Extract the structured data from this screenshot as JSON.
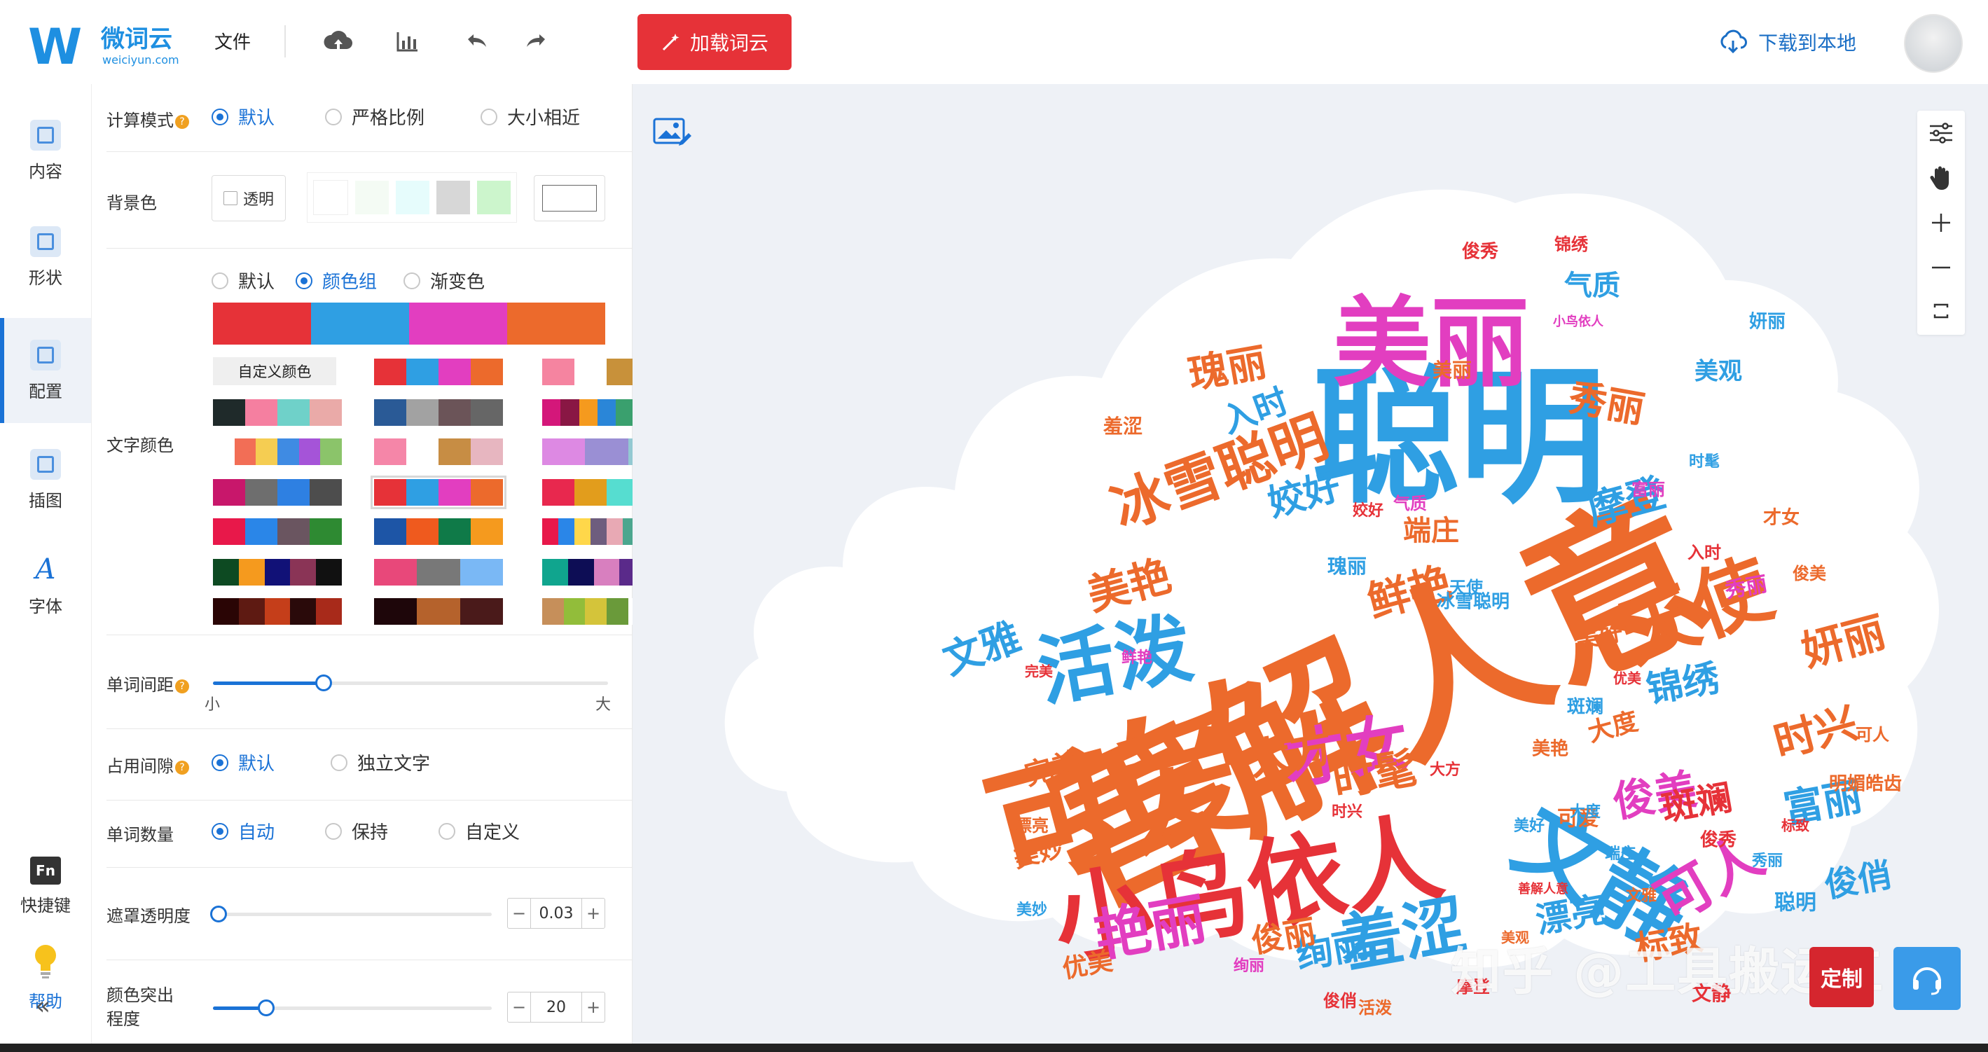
{
  "app": {
    "logo_mark": "W",
    "logo_name": "微词云",
    "logo_url": "weiciyun.com",
    "menu_file": "文件",
    "load_button": "加载词云",
    "download_label": "下载到本地"
  },
  "nav": {
    "items": [
      {
        "label": "内容",
        "icon": "content-icon"
      },
      {
        "label": "形状",
        "icon": "shape-icon"
      },
      {
        "label": "配置",
        "icon": "config-icon"
      },
      {
        "label": "插图",
        "icon": "illustration-icon"
      },
      {
        "label": "字体",
        "icon": "font-icon"
      }
    ],
    "active": "配置",
    "shortcut_label": "快捷键",
    "shortcut_icon_text": "Fn",
    "help_label": "帮助"
  },
  "settings": {
    "calc_mode": {
      "label": "计算模式",
      "options": [
        "默认",
        "严格比例",
        "大小相近"
      ],
      "selected": "默认"
    },
    "background": {
      "label": "背景色",
      "transparent_label": "透明",
      "swatches": [
        "#ffffff",
        "#f4fbf4",
        "#e6fcfc",
        "#d7d7d7",
        "#ccf5cc",
        "#ffd4d4"
      ],
      "current": "#ffffff"
    },
    "text_color": {
      "label": "文字颜色",
      "modes": [
        "默认",
        "颜色组",
        "渐变色"
      ],
      "selected": "颜色组",
      "current_palette": [
        "#e63238",
        "#2f9fe3",
        "#e23ec0",
        "#ec6a2c"
      ],
      "custom_label": "自定义颜色",
      "palettes": [
        [
          "#e63238",
          "#2f9fe3",
          "#e23ec0",
          "#ec6a2c"
        ],
        [
          "#f584a0",
          "#ffffff",
          "#c8913a",
          "#e6b2bd"
        ],
        [
          "#1f2a2a",
          "#f57fa0",
          "#6fd1c9",
          "#eaaaa8"
        ],
        [
          "#2a5a96",
          "#a2a2a2",
          "#6b5458",
          "#666666"
        ],
        [
          "#d4177a",
          "#891744",
          "#f59a1e",
          "#2a86d8",
          "#3aa06e",
          "#999999",
          "#5d5d5d"
        ],
        [
          "#ffffff",
          "#f26e56",
          "#f5cd52",
          "#3f8be3",
          "#a554d8",
          "#8bc46a"
        ],
        [
          "#f586a8",
          "#ffffff",
          "#c78d44",
          "#e7b6c0"
        ],
        [
          "#dd89e3",
          "#9a8fd4",
          "#93c9d2"
        ],
        [
          "#c8176b",
          "#6e6e6e",
          "#2e80e2",
          "#4d4d4d"
        ],
        [
          "#e63238",
          "#2f9fe3",
          "#e23ec0",
          "#ec6a2c"
        ],
        [
          "#e8284e",
          "#e29d1c",
          "#56ddd0",
          "#f7649e"
        ],
        [
          "#e8184a",
          "#2a86e8",
          "#6a5560",
          "#2e8a32"
        ],
        [
          "#1d55a6",
          "#ef5a1e",
          "#0f7a48",
          "#f59a1e"
        ],
        [
          "#e8184a",
          "#2a86e8",
          "#ffd74a",
          "#6e5d7e",
          "#e8a9b4",
          "#4ba68e",
          "#d2b04e",
          "#a1a52c"
        ],
        [
          "#0d4a22",
          "#f59a1e",
          "#111177",
          "#8a3456",
          "#111111"
        ],
        [
          "#e8487a",
          "#787878",
          "#7ab8f5"
        ],
        [
          "#10a58e",
          "#0d0d55",
          "#d87fbf",
          "#5a2a8a",
          "#69f5c1"
        ],
        [
          "#2a0505",
          "#5e1a12",
          "#c53e1a",
          "#2a0a0a",
          "#a82a1a"
        ],
        [
          "#1e060a",
          "#b5622c",
          "#4a1a1a"
        ],
        [
          "#c68f5a",
          "#92bd3a",
          "#d4c43a",
          "#6a9a3a",
          "#ffffff",
          "#a8581a"
        ]
      ]
    },
    "word_spacing": {
      "label": "单词间距",
      "min_label": "小",
      "max_label": "大",
      "value": 0.28
    },
    "occupy_spacing": {
      "label": "占用间隙",
      "options": [
        "默认",
        "独立文字"
      ],
      "selected": "默认"
    },
    "word_count": {
      "label": "单词数量",
      "options": [
        "自动",
        "保持",
        "自定义"
      ],
      "selected": "自动"
    },
    "mask_opacity": {
      "label": "遮罩透明度",
      "value": "0.03",
      "slider": 0.0
    },
    "color_highlight": {
      "label": "颜色突出程度",
      "label_line1": "颜色突出",
      "label_line2": "程度",
      "value": "20",
      "slider": 0.19
    },
    "minus": "−",
    "plus": "+"
  },
  "canvas": {
    "watermark": "知乎 @工具搬运工",
    "badge_text": "定制",
    "colors": {
      "red": "#e63238",
      "blue": "#2f9fe3",
      "magenta": "#e23ec0",
      "orange": "#ec6a2c",
      "cloud": "#ffffff"
    },
    "words": [
      {
        "text": "善解人意",
        "c": "orange",
        "rot": -25
      },
      {
        "text": "聪明",
        "c": "blue",
        "rot": 0
      },
      {
        "text": "可爱",
        "c": "orange",
        "rot": -15
      },
      {
        "text": "美丽",
        "c": "magenta",
        "rot": 0
      },
      {
        "text": "小鸟依人",
        "c": "red",
        "rot": -10
      },
      {
        "text": "文静",
        "c": "blue",
        "rot": 30
      },
      {
        "text": "活泼",
        "c": "blue",
        "rot": -10
      },
      {
        "text": "天使",
        "c": "orange",
        "rot": -20
      },
      {
        "text": "冰雪聪明",
        "c": "orange",
        "rot": -20
      },
      {
        "text": "才女",
        "c": "magenta",
        "rot": -10
      },
      {
        "text": "羞涩",
        "c": "blue",
        "rot": -10
      },
      {
        "text": "艳丽",
        "c": "magenta",
        "rot": -10
      },
      {
        "text": "可人",
        "c": "magenta",
        "rot": -30
      },
      {
        "text": "时髦",
        "c": "orange",
        "rot": -10
      },
      {
        "text": "鲜艳",
        "c": "orange",
        "rot": -15
      },
      {
        "text": "美艳",
        "c": "orange",
        "rot": -15
      },
      {
        "text": "锦绣",
        "c": "blue",
        "rot": -10
      },
      {
        "text": "时兴",
        "c": "orange",
        "rot": -15
      },
      {
        "text": "富丽",
        "c": "blue",
        "rot": -10
      },
      {
        "text": "妍丽",
        "c": "orange",
        "rot": -15
      },
      {
        "text": "瑰丽",
        "c": "orange",
        "rot": -10
      },
      {
        "text": "秀丽",
        "c": "orange",
        "rot": 10
      },
      {
        "text": "俊美",
        "c": "magenta",
        "rot": -10
      },
      {
        "text": "绚丽",
        "c": "blue",
        "rot": -10
      },
      {
        "text": "漂亮",
        "c": "blue",
        "rot": -10
      },
      {
        "text": "俊丽",
        "c": "orange",
        "rot": -10
      },
      {
        "text": "摩登",
        "c": "blue",
        "rot": -15
      },
      {
        "text": "大方",
        "c": "orange",
        "rot": -10
      },
      {
        "text": "斑斓",
        "c": "red",
        "rot": -10
      },
      {
        "text": "姣好",
        "c": "blue",
        "rot": -15
      },
      {
        "text": "文雅",
        "c": "blue",
        "rot": -20
      },
      {
        "text": "入时",
        "c": "blue",
        "rot": -20
      },
      {
        "text": "俊俏",
        "c": "blue",
        "rot": -10
      },
      {
        "text": "标致",
        "c": "orange",
        "rot": -10
      },
      {
        "text": "美好",
        "c": "orange",
        "rot": -10
      },
      {
        "text": "完美",
        "c": "orange",
        "rot": -15
      },
      {
        "text": "大度",
        "c": "orange",
        "rot": -15
      },
      {
        "text": "端庄",
        "c": "orange",
        "rot": 0
      },
      {
        "text": "美妙",
        "c": "orange",
        "rot": -15
      },
      {
        "text": "优美",
        "c": "orange",
        "rot": -10
      },
      {
        "text": "气质",
        "c": "blue",
        "rot": 0
      },
      {
        "text": "美观",
        "c": "blue",
        "rot": 0
      },
      {
        "text": "秀丽",
        "c": "magenta",
        "rot": -10
      },
      {
        "text": "明媚皓齿",
        "c": "orange",
        "rot": 0
      },
      {
        "text": "美丽",
        "c": "orange",
        "rot": 0
      },
      {
        "text": "冰雪聪明",
        "c": "blue",
        "rot": 0
      },
      {
        "text": "妍丽",
        "c": "blue",
        "rot": 0
      },
      {
        "text": "锦绣",
        "c": "red",
        "rot": 0
      },
      {
        "text": "俊秀",
        "c": "red",
        "rot": 0
      },
      {
        "text": "气质",
        "c": "magenta",
        "rot": 0
      },
      {
        "text": "可爱",
        "c": "orange",
        "rot": 0
      },
      {
        "text": "聪明",
        "c": "blue",
        "rot": 0
      },
      {
        "text": "羞涩",
        "c": "orange",
        "rot": 0
      },
      {
        "text": "俊秀",
        "c": "red",
        "rot": 0
      },
      {
        "text": "美艳",
        "c": "orange",
        "rot": 0
      },
      {
        "text": "小鸟依人",
        "c": "magenta",
        "rot": 0
      },
      {
        "text": "时兴",
        "c": "red",
        "rot": 0
      },
      {
        "text": "瑰丽",
        "c": "blue",
        "rot": 0
      },
      {
        "text": "善解人意",
        "c": "red",
        "rot": 0
      },
      {
        "text": "天使",
        "c": "blue",
        "rot": 0
      },
      {
        "text": "鲜艳",
        "c": "magenta",
        "rot": 0
      },
      {
        "text": "漂亮",
        "c": "orange",
        "rot": 0
      },
      {
        "text": "入时",
        "c": "red",
        "rot": 0
      },
      {
        "text": "优美",
        "c": "red",
        "rot": 0
      },
      {
        "text": "文雅",
        "c": "orange",
        "rot": 0
      },
      {
        "text": "可人",
        "c": "orange",
        "rot": 0
      },
      {
        "text": "斑斓",
        "c": "blue",
        "rot": 0
      },
      {
        "text": "活泼",
        "c": "orange",
        "rot": 0
      },
      {
        "text": "摩登",
        "c": "red",
        "rot": 0
      },
      {
        "text": "大度",
        "c": "blue",
        "rot": 0
      },
      {
        "text": "端庄",
        "c": "blue",
        "rot": 0
      },
      {
        "text": "标致",
        "c": "red",
        "rot": 0
      },
      {
        "text": "完美",
        "c": "red",
        "rot": 0
      },
      {
        "text": "美妙",
        "c": "blue",
        "rot": 0
      },
      {
        "text": "姣好",
        "c": "red",
        "rot": 0
      },
      {
        "text": "绚丽",
        "c": "magenta",
        "rot": 0
      },
      {
        "text": "俊俏",
        "c": "red",
        "rot": 0
      },
      {
        "text": "文静",
        "c": "red",
        "rot": 0
      },
      {
        "text": "美观",
        "c": "orange",
        "rot": 0
      },
      {
        "text": "富丽",
        "c": "magenta",
        "rot": 0
      },
      {
        "text": "俊美",
        "c": "orange",
        "rot": 0
      },
      {
        "text": "时髦",
        "c": "blue",
        "rot": 0
      },
      {
        "text": "大方",
        "c": "red",
        "rot": 0
      },
      {
        "text": "美好",
        "c": "blue",
        "rot": 0
      },
      {
        "text": "才女",
        "c": "orange",
        "rot": 0
      },
      {
        "text": "秀丽",
        "c": "blue",
        "rot": 0
      }
    ]
  }
}
